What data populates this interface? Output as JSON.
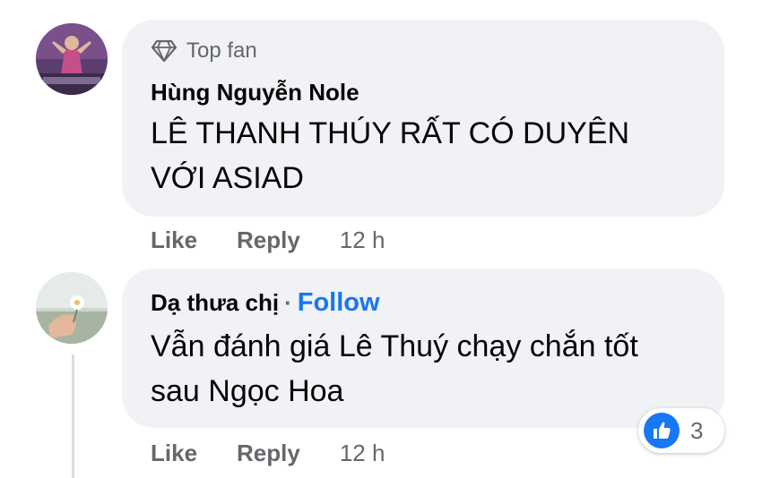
{
  "comments": [
    {
      "badge": "Top fan",
      "author": "Hùng Nguyễn Nole",
      "text_lines": [
        "LÊ THANH THÚY RẤT CÓ DUYÊN",
        "VỚI ASIAD"
      ],
      "actions": {
        "like": "Like",
        "reply": "Reply",
        "time": "12 h"
      }
    },
    {
      "author": "Dạ thưa chị",
      "separator": "·",
      "follow": "Follow",
      "text_lines": [
        "Vẫn đánh giá Lê Thuý chạy chắn tốt",
        "sau Ngọc Hoa"
      ],
      "actions": {
        "like": "Like",
        "reply": "Reply",
        "time": "12 h"
      },
      "reactions": {
        "icon": "thumbs-up-icon",
        "count": "3"
      }
    }
  ],
  "colors": {
    "bubble": "#f0f2f5",
    "text": "#050505",
    "secondary": "#65676b",
    "accent": "#1877f2"
  }
}
